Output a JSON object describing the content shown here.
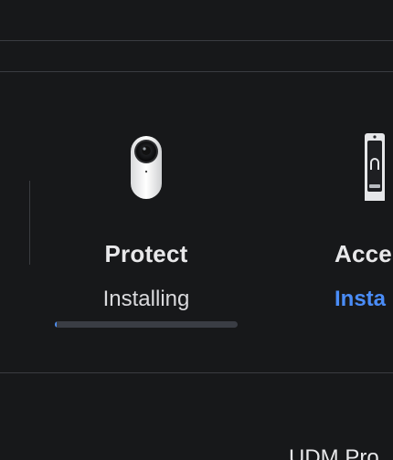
{
  "apps": [
    {
      "name": "Protect",
      "status": "Installing",
      "progress": 0.01,
      "icon": "camera-icon",
      "accent": "#4f8ff2"
    },
    {
      "name": "Acces",
      "status": "Insta",
      "icon": "access-reader-icon",
      "status_color": "#4a8cf7"
    }
  ],
  "device": {
    "label": "UDM Pro"
  }
}
